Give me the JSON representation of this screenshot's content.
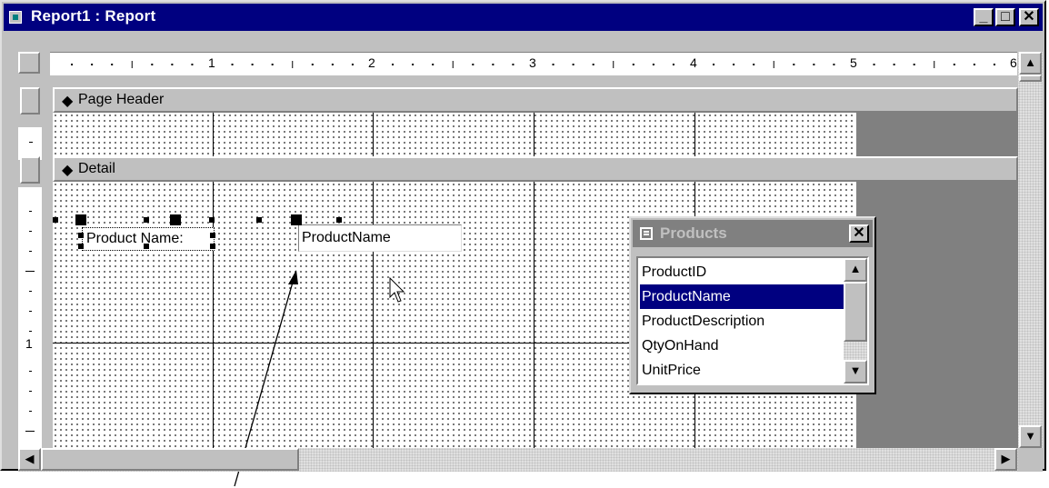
{
  "window": {
    "title": "Report1 : Report"
  },
  "title_buttons": {
    "minimize": "_",
    "maximize": "□",
    "close": "✕"
  },
  "ruler": {
    "numbers": [
      "1",
      "2",
      "3",
      "4",
      "5",
      "6"
    ],
    "left_number": "1"
  },
  "sections": {
    "page_header": "Page Header",
    "detail": "Detail",
    "section_symbol": "◆"
  },
  "controls": {
    "label_text": "Product Name:",
    "textbox_text": "ProductName"
  },
  "field_list": {
    "title": "Products",
    "close": "✕",
    "items": [
      "ProductID",
      "ProductName",
      "ProductDescription",
      "QtyOnHand",
      "UnitPrice"
    ],
    "selected_index": 1
  },
  "scroll_arrows": {
    "up": "▲",
    "down": "▼",
    "left": "◀",
    "right": "▶"
  },
  "colors": {
    "title_active": "#000080",
    "title_inactive": "#808080",
    "face": "#c0c0c0",
    "selection": "#000080"
  }
}
